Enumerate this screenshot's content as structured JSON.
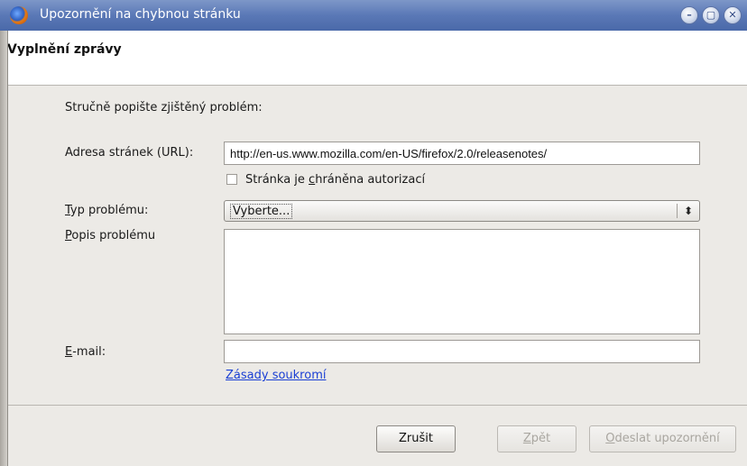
{
  "window": {
    "title": "Upozornění na chybnou stránku",
    "controls": {
      "minimize": "–",
      "maximize": "▢",
      "close": "✕"
    }
  },
  "header": {
    "title": "Vyplnění zprávy"
  },
  "form": {
    "intro": "Stručně popište zjištěný problém:",
    "url_label": "Adresa stránek (URL):",
    "url_value": "http://en-us.www.mozilla.com/en-US/firefox/2.0/releasenotes/",
    "auth_checkbox": {
      "label_pre": "Stránka je ",
      "label_accel": "c",
      "label_post": "hráněna autorizací",
      "checked": false
    },
    "type_label_accel": "T",
    "type_label_rest": "yp problému:",
    "type_value": "Vyberte...",
    "desc_label_accel": "P",
    "desc_label_rest": "opis problému",
    "desc_value": "",
    "email_label_accel": "E",
    "email_label_rest": "-mail:",
    "email_value": "",
    "privacy_link": "Zásady soukromí"
  },
  "buttons": {
    "cancel": "Zrušit",
    "back_accel": "Z",
    "back_rest": "pět",
    "submit_accel": "O",
    "submit_rest": "deslat upozornění"
  },
  "icons": {
    "app": "firefox-icon",
    "select_arrows": "⬍"
  }
}
